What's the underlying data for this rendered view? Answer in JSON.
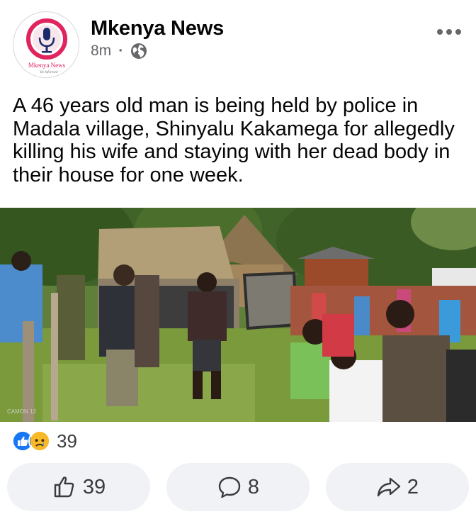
{
  "post": {
    "page_name": "Mkenya News",
    "time": "8m",
    "separator": "·",
    "audience_icon": "globe-icon",
    "more_icon": "more-horizontal-icon",
    "text": "A 46 years old man is being held by police in Madala village, Shinyalu Kakamega for allegedly killing his wife and staying with her dead body in their house for one week.",
    "avatar": {
      "logo_text": "Mkenya News",
      "logo_subtext": "Be Informed",
      "colors": {
        "ring": "#e0245e",
        "mic": "#1c2c6b"
      }
    },
    "photo": {
      "watermark": "CAMON 12"
    }
  },
  "reactions": {
    "icons": [
      "like-reaction-icon",
      "sad-reaction-icon"
    ],
    "count": "39"
  },
  "actions": {
    "like_count": "39",
    "comment_count": "8",
    "share_count": "2"
  },
  "colors": {
    "like_blue": "#1877f2",
    "sad_yellow": "#f7b928",
    "button_bg": "#f0f2f5",
    "meta_gray": "#65676b"
  }
}
